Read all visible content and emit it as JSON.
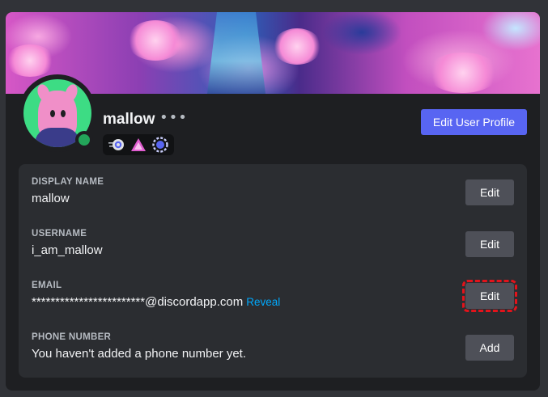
{
  "profile": {
    "name": "mallow",
    "more_label": "•••",
    "edit_profile_label": "Edit User Profile",
    "status": "online",
    "badges": [
      "nitro-icon",
      "hypesquad-balance-icon",
      "quest-badge-icon"
    ]
  },
  "fields": [
    {
      "label": "DISPLAY NAME",
      "value": "mallow",
      "button": "Edit"
    },
    {
      "label": "USERNAME",
      "value": "i_am_mallow",
      "button": "Edit"
    },
    {
      "label": "EMAIL",
      "value": "************************@discordapp.com",
      "reveal": "Reveal",
      "button": "Edit"
    },
    {
      "label": "PHONE NUMBER",
      "value": "You haven't added a phone number yet.",
      "button": "Add"
    }
  ],
  "colors": {
    "accent": "#5865f2",
    "online": "#23a55a",
    "link": "#00a8fc",
    "highlight": "#e3131b"
  }
}
